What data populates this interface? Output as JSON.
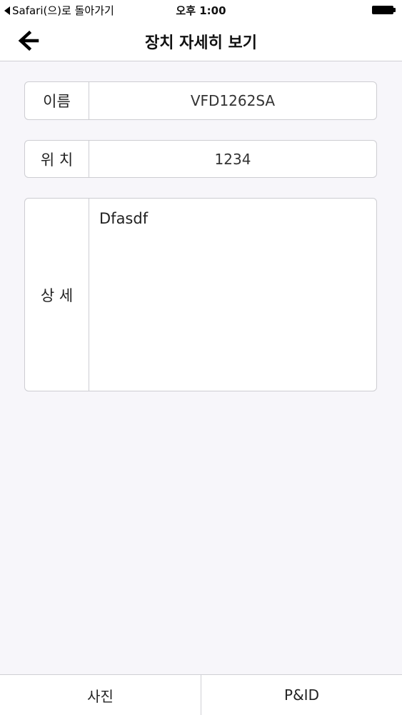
{
  "status_bar": {
    "back_text": "Safari(으)로 돌아가기",
    "time": "오후 1:00"
  },
  "nav": {
    "title": "장치 자세히 보기",
    "back_icon": "arrow-left-icon"
  },
  "fields": {
    "name": {
      "label": "이름",
      "value": "VFD1262SA"
    },
    "location": {
      "label": "위 치",
      "value": "1234"
    },
    "detail": {
      "label": "상 세",
      "value": "Dfasdf"
    }
  },
  "tabs": [
    {
      "label": "사진"
    },
    {
      "label": "P&ID"
    }
  ],
  "colors": {
    "background": "#f7f6fa",
    "surface": "#ffffff",
    "border": "#cdcdd2",
    "text": "#111111"
  }
}
